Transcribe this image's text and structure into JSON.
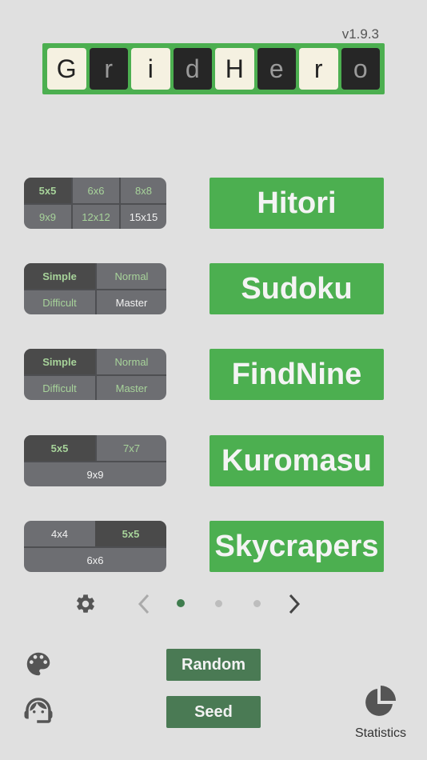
{
  "version": "v1.9.3",
  "logo": {
    "letters": [
      "G",
      "r",
      "i",
      "d",
      "H",
      "e",
      "r",
      "o"
    ]
  },
  "games": {
    "hitori": {
      "name": "Hitori",
      "options": [
        "5x5",
        "6x6",
        "8x8",
        "9x9",
        "12x12",
        "15x15"
      ],
      "selected": "5x5"
    },
    "sudoku": {
      "name": "Sudoku",
      "options": [
        "Simple",
        "Normal",
        "Difficult",
        "Master"
      ],
      "selected": "Simple"
    },
    "findnine": {
      "name": "FindNine",
      "options": [
        "Simple",
        "Normal",
        "Difficult",
        "Master"
      ],
      "selected": "Simple"
    },
    "kuromasu": {
      "name": "Kuromasu",
      "options": [
        "5x5",
        "7x7",
        "9x9"
      ],
      "selected": "5x5"
    },
    "skycrapers": {
      "name": "Skycrapers",
      "options": [
        "4x4",
        "5x5",
        "6x6"
      ],
      "selected": "5x5"
    }
  },
  "pager": {
    "page": 1,
    "total": 3
  },
  "bottom": {
    "random_label": "Random",
    "seed_label": "Seed",
    "statistics_label": "Statistics"
  },
  "colors": {
    "accent": "#4caf50",
    "dark_button": "#4a7a54",
    "background": "#e0e0e0"
  },
  "icons": [
    "gear-icon",
    "chevron-left-icon",
    "chevron-right-icon",
    "palette-icon",
    "support-agent-icon",
    "pie-chart-icon"
  ]
}
